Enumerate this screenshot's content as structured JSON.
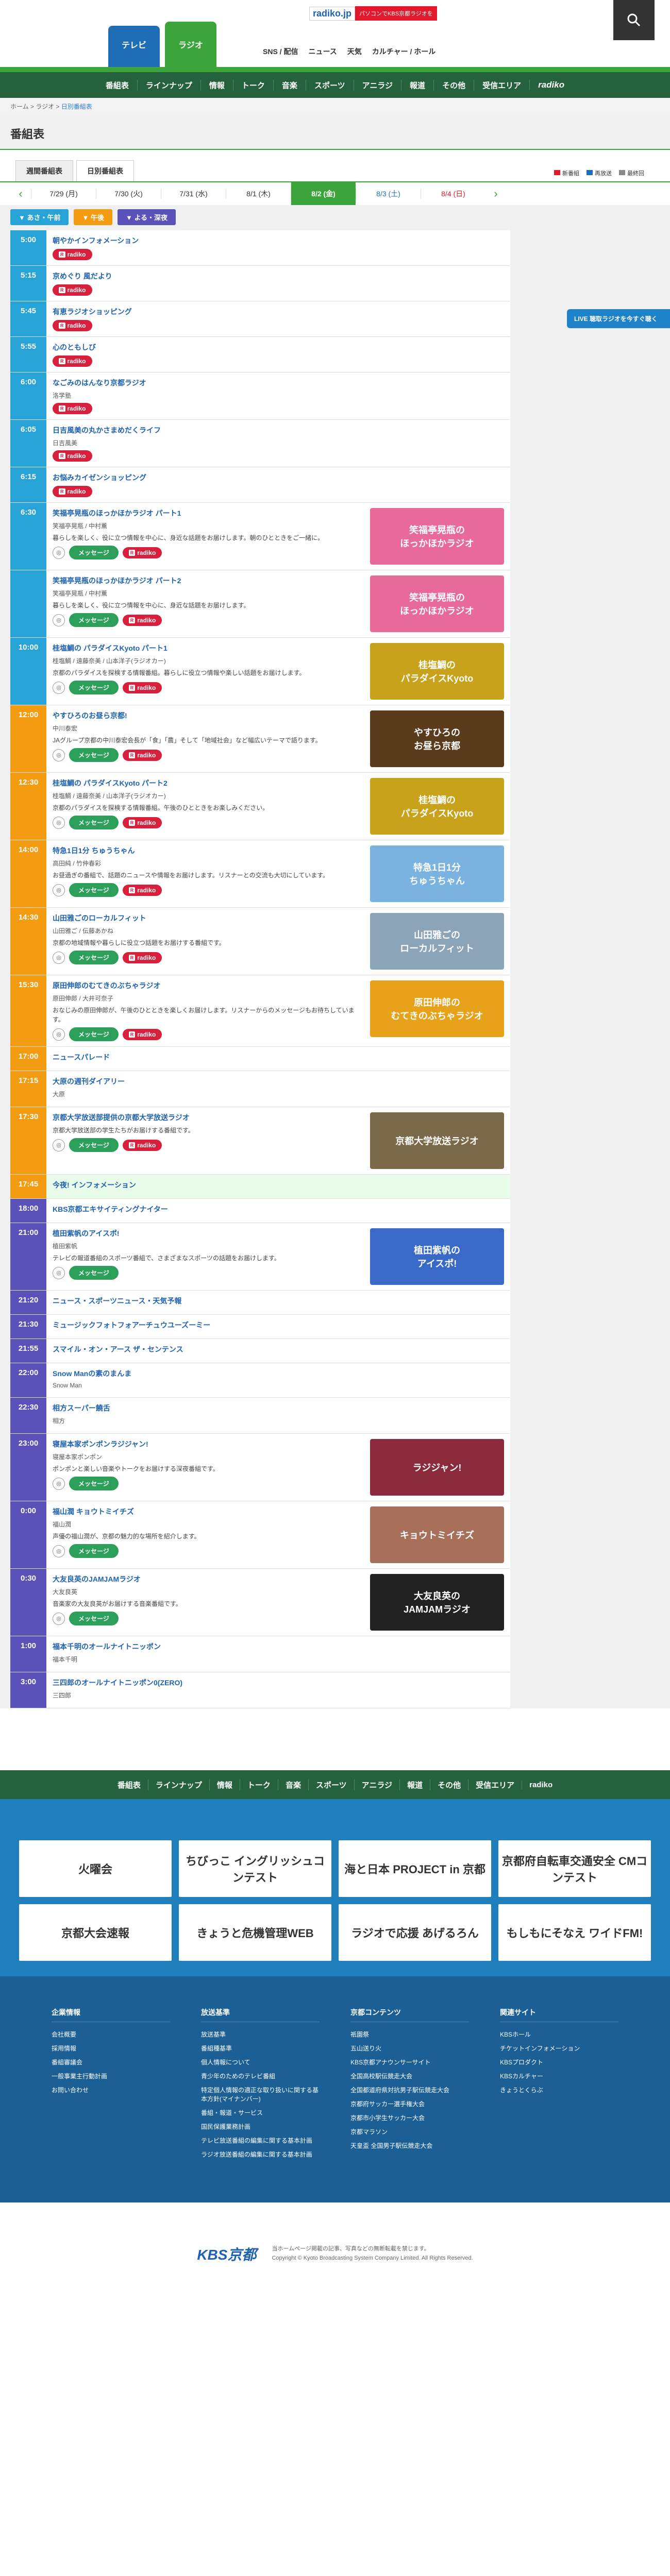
{
  "header": {
    "rb_logo": "radiko.jp",
    "rb_banner": "パソコンでKBS京都ラジオを",
    "tab_tv": "テレビ",
    "tab_radio": "ラジオ",
    "topnav": [
      "SNS / 配信",
      "ニュース",
      "天気",
      "カルチャー / ホール"
    ],
    "subnav": [
      "番組表",
      "ラインナップ",
      "情報",
      "トーク",
      "音楽",
      "スポーツ",
      "アニラジ",
      "報道",
      "その他",
      "受信エリア",
      "radiko"
    ]
  },
  "breadcrumb": {
    "home": "ホーム",
    "radio": "ラジオ",
    "current": "日別番組表"
  },
  "page_title": "番組表",
  "view_tabs": [
    "週間番組表",
    "日別番組表"
  ],
  "legend": [
    "新番組",
    "再放送",
    "最終回"
  ],
  "dates": [
    {
      "label": "7/29 (月)",
      "cls": ""
    },
    {
      "label": "7/30 (火)",
      "cls": ""
    },
    {
      "label": "7/31 (水)",
      "cls": ""
    },
    {
      "label": "8/1 (木)",
      "cls": ""
    },
    {
      "label": "8/2 (金)",
      "cls": "on"
    },
    {
      "label": "8/3 (土)",
      "cls": "sat"
    },
    {
      "label": "8/4 (日)",
      "cls": "sun"
    }
  ],
  "bands": [
    {
      "label": "▼ あさ・午前",
      "color": "#27a3d8"
    },
    {
      "label": "▼ 午後",
      "color": "#f39c12"
    },
    {
      "label": "▼ よる・深夜",
      "color": "#5a52b8"
    }
  ],
  "live_badge": "LIVE 聴取ラジオを今すぐ聴く",
  "radiko_label": "radiko",
  "message_label": "メッセージ",
  "programs": [
    {
      "time": "5:00",
      "band": "morn",
      "title": "朝やかインフォメーション",
      "radiko": true
    },
    {
      "time": "5:15",
      "band": "morn",
      "title": "京めぐり 風だより",
      "radiko": true
    },
    {
      "time": "5:45",
      "band": "morn",
      "title": "有恵ラジオショッピング",
      "radiko": true
    },
    {
      "time": "5:55",
      "band": "morn",
      "title": "心のともしび",
      "radiko": true
    },
    {
      "time": "6:00",
      "band": "morn",
      "title": "なごみのはんなり京都ラジオ",
      "cast": "洛学塾",
      "radiko": true
    },
    {
      "time": "6:05",
      "band": "morn",
      "title": "日吉風美の丸かさまめだくライフ",
      "cast": "日吉風美",
      "radiko": true
    },
    {
      "time": "6:15",
      "band": "morn",
      "title": "お悩みカイゼンショッピング",
      "radiko": true
    },
    {
      "time": "6:30",
      "band": "morn",
      "title": "笑福亭晃瓶のほっかほかラジオ パート1",
      "cast": "笑福亭晃瓶 / 中村薫",
      "desc": "暮らしを楽しく、役に立つ情報を中心に、身近な話題をお届けします。朝のひとときをご一緒に。",
      "msg": true,
      "radiko": true,
      "thumb": "笑福亭晃瓶の\nほっかほかラジオ",
      "thumbColor": "#e86a9b"
    },
    {
      "time": "",
      "band": "morn",
      "title": "笑福亭晃瓶のほっかほかラジオ パート2",
      "cast": "笑福亭晃瓶 / 中村薫",
      "desc": "暮らしを楽しく、役に立つ情報を中心に、身近な話題をお届けします。",
      "msg": true,
      "radiko": true,
      "thumb": "笑福亭晃瓶の\nほっかほかラジオ",
      "thumbColor": "#e86a9b"
    },
    {
      "time": "10:00",
      "band": "morn",
      "title": "桂塩鯛の パラダイスKyoto パート1",
      "cast": "桂塩鯛 / 遠藤奈美 / 山本洋子(ラジオカー)",
      "desc": "京都のパラダイスを探検する情報番組。暮らしに役立つ情報や楽しい話題をお届けします。",
      "msg": true,
      "radiko": true,
      "thumb": "桂塩鯛の\nパラダイスKyoto",
      "thumbColor": "#c7a21a"
    },
    {
      "time": "12:00",
      "band": "noon",
      "title": "やすひろのお昼ら京都!",
      "cast": "中川泰宏",
      "desc": "JAグループ京都の中川泰宏会長が「食」「農」そして「地域社会」など幅広いテーマで語ります。",
      "msg": true,
      "radiko": true,
      "thumb": "やすひろの\nお昼ら京都",
      "thumbColor": "#5a3b1b"
    },
    {
      "time": "12:30",
      "band": "noon",
      "title": "桂塩鯛の パラダイスKyoto パート2",
      "cast": "桂塩鯛 / 遠藤奈美 / 山本洋子(ラジオカー)",
      "desc": "京都のパラダイスを探検する情報番組。午後のひとときをお楽しみください。",
      "msg": true,
      "radiko": true,
      "thumb": "桂塩鯛の\nパラダイスKyoto",
      "thumbColor": "#c7a21a"
    },
    {
      "time": "14:00",
      "band": "noon",
      "title": "特急1日1分 ちゅうちゃん",
      "cast": "高田純 / 竹仲春彩",
      "desc": "お昼過ぎの番組で、話題のニュースや情報をお届けします。リスナーとの交流も大切にしています。",
      "msg": true,
      "radiko": true,
      "thumb": "特急1日1分\nちゅうちゃん",
      "thumbColor": "#7ab3e0"
    },
    {
      "time": "14:30",
      "band": "noon",
      "title": "山田雅ごのローカルフィット",
      "cast": "山田雅ご / 伝藤あかね",
      "desc": "京都の地域情報や暮らしに役立つ話題をお届けする番組です。",
      "msg": true,
      "radiko": true,
      "thumb": "山田雅ごの\nローカルフィット",
      "thumbColor": "#8ca4b8"
    },
    {
      "time": "15:30",
      "band": "noon",
      "title": "原田伸郎のむてきのぶちゃラジオ",
      "cast": "原田伸郎 / 大井可奈子",
      "desc": "おなじみの原田伸郎が、午後のひとときを楽しくお届けします。リスナーからのメッセージもお待ちしています。",
      "msg": true,
      "radiko": true,
      "thumb": "原田伸郎の\nむてきのぶちゃラジオ",
      "thumbColor": "#e8a21a"
    },
    {
      "time": "17:00",
      "band": "noon",
      "title": "ニュースパレード"
    },
    {
      "time": "17:15",
      "band": "noon",
      "title": "大原の週刊ダイアリー",
      "cast": "大原"
    },
    {
      "time": "17:30",
      "band": "noon",
      "title": "京都大学放送部提供の京都大学放送ラジオ",
      "desc": "京都大学放送部の学生たちがお届けする番組です。",
      "msg": true,
      "radiko": true,
      "thumb": "京都大学放送ラジオ",
      "thumbColor": "#7a6a4a"
    },
    {
      "time": "17:45",
      "band": "noon",
      "title": "今夜! インフォメーション",
      "current": true
    },
    {
      "time": "18:00",
      "band": "night",
      "title": "KBS京都エキサイティングナイター"
    },
    {
      "time": "21:00",
      "band": "night",
      "title": "植田紫帆のアイスポ!",
      "cast": "植田紫帆",
      "desc": "テレビの報道番組のスポーツ番組で、さまざまなスポーツの話題をお届けします。",
      "msg": true,
      "thumb": "植田紫帆の\nアイスポ!",
      "thumbColor": "#3a6ac8"
    },
    {
      "time": "21:20",
      "band": "night",
      "title": "ニュース・スポーツニュース・天気予報"
    },
    {
      "time": "21:30",
      "band": "night",
      "title": "ミュージックフォトフォアーチュウユーズーミー"
    },
    {
      "time": "21:55",
      "band": "night",
      "title": "スマイル・オン・アース ザ・センテンス"
    },
    {
      "time": "22:00",
      "band": "night",
      "title": "Snow Manの素のまんま",
      "cast": "Snow Man"
    },
    {
      "time": "22:30",
      "band": "night",
      "title": "相方スーパー饒舌",
      "cast": "相方"
    },
    {
      "time": "23:00",
      "band": "night",
      "title": "寝屋本家ポンポンラジジャン!",
      "cast": "寝屋本家ポンポン",
      "desc": "ポンポンと楽しい音楽やトークをお届けする深夜番組です。",
      "msg": true,
      "thumb": "ラジジャン!",
      "thumbColor": "#8a2a3a"
    },
    {
      "time": "0:00",
      "band": "night",
      "title": "福山潤 キョウトミイチズ",
      "cast": "福山潤",
      "desc": "声優の福山潤が、京都の魅力的な場所を紹介します。",
      "msg": true,
      "thumb": "キョウトミイチズ",
      "thumbColor": "#a8705a"
    },
    {
      "time": "0:30",
      "band": "night",
      "title": "大友良英のJAMJAMラジオ",
      "cast": "大友良英",
      "desc": "音楽家の大友良英がお届けする音楽番組です。",
      "msg": true,
      "thumb": "大友良英の\nJAMJAMラジオ",
      "thumbColor": "#222222"
    },
    {
      "time": "1:00",
      "band": "night",
      "title": "福本千明のオールナイトニッポン",
      "cast": "福本千明"
    },
    {
      "time": "3:00",
      "band": "night",
      "title": "三四郎のオールナイトニッポン0(ZERO)",
      "cast": "三四郎"
    }
  ],
  "footer_banners": [
    "火曜会",
    "ちびっこ イングリッシュコンテスト",
    "海と日本 PROJECT in 京都",
    "京都府自転車交通安全 CMコンテスト",
    "京都大会速報",
    "きょうと危機管理WEB",
    "ラジオで応援 あげるろん",
    "もしもにそなえ ワイドFM!"
  ],
  "sitemap": [
    {
      "head": "企業情報",
      "items": [
        "会社概要",
        "採用情報",
        "番組審議会",
        "一般事業主行動計画",
        "お問い合わせ"
      ]
    },
    {
      "head": "放送基準",
      "items": [
        "放送基準",
        "番組種基準",
        "個人情報について",
        "青少年のためのテレビ番組",
        "特定個人情報の適正な取り扱いに関する基本方針(マイナンバー)",
        "番組・報道・サービス",
        "国民保護業務計画",
        "テレビ放送番組の編集に関する基本計画",
        "ラジオ放送番組の編集に関する基本計画"
      ]
    },
    {
      "head": "京都コンテンツ",
      "items": [
        "祇園祭",
        "五山送り火",
        "KBS京都アナウンサーサイト",
        "全国高校駅伝競走大会",
        "全国都道府県対抗男子駅伝競走大会",
        "京都府サッカー選手権大会",
        "京都市小学生サッカー大会",
        "京都マラソン",
        "天皇盃 全国男子駅伝競走大会"
      ]
    },
    {
      "head": "関連サイト",
      "items": [
        "KBSホール",
        "チケットインフォメーション",
        "KBSプロダクト",
        "KBSカルチャー",
        "きょうとくらぶ"
      ]
    }
  ],
  "bottom": {
    "logo": "KBS京都",
    "copy1": "当ホームページ掲載の記事、写真などの無断転載を禁じます。",
    "copy2": "Copyright © Kyoto Broadcasting System Company Limited. All Rights Reserved."
  }
}
